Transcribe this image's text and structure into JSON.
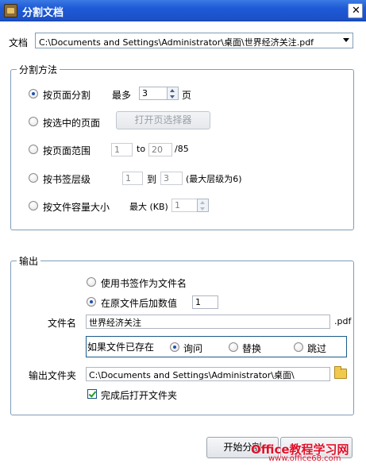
{
  "window": {
    "title": "分割文档"
  },
  "document": {
    "label": "文档",
    "path": "C:\\Documents and Settings\\Administrator\\桌面\\世界经济关注.pdf"
  },
  "split_method": {
    "legend": "分割方法",
    "by_page": {
      "label": "按页面分割",
      "max_label": "最多",
      "value": "3",
      "unit": "页"
    },
    "by_selected": {
      "label": "按选中的页面",
      "button": "打开页选择器"
    },
    "by_range": {
      "label": "按页面范围",
      "from": "1",
      "to_label": "to",
      "to": "20",
      "total": "/85"
    },
    "by_bookmark": {
      "label": "按书签层级",
      "from": "1",
      "to_label": "到",
      "to": "3",
      "note": "(最大层级为6)"
    },
    "by_size": {
      "label": "按文件容量大小",
      "max_label": "最大 (KB)",
      "value": "1"
    }
  },
  "output": {
    "legend": "输出",
    "use_bookmark": "使用书签作为文件名",
    "append_number": "在原文件后加数值",
    "append_value": "1",
    "filename_label": "文件名",
    "filename": "世界经济关注",
    "ext": ".pdf",
    "if_exists": {
      "label": "如果文件已存在",
      "options": [
        "询问",
        "替换",
        "跳过"
      ]
    },
    "folder_label": "输出文件夹",
    "folder": "C:\\Documents and Settings\\Administrator\\桌面\\",
    "open_after": "完成后打开文件夹"
  },
  "buttons": {
    "start": "开始分割"
  },
  "watermark": {
    "brand": "Office教程学习网",
    "url": "www.office68.com"
  },
  "colors": {
    "title_bar": "#245edb",
    "group_border": "#7f9db9",
    "watermark_red": "#e0102a"
  }
}
